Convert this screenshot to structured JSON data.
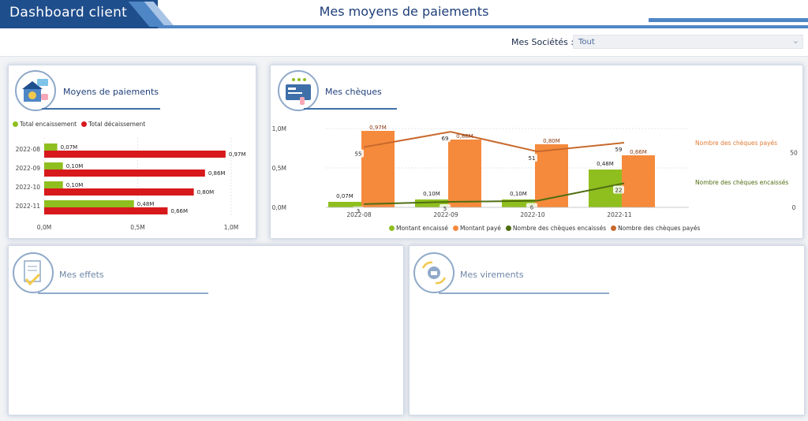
{
  "header": {
    "app_title": "Dashboard client",
    "page_title": "Mes moyens de paiements"
  },
  "filter": {
    "label": "Mes Sociétés :",
    "value": "Tout"
  },
  "panels": {
    "moyens": {
      "title": "Moyens de paiements",
      "legend": [
        "Total encaissement",
        "Total décaissement"
      ]
    },
    "cheques": {
      "title": "Mes chèques",
      "legend": [
        "Montant encaissé",
        "Montant payé",
        "Nombre des chèques encaissés",
        "Nombre des chèques payés"
      ],
      "right_labels": [
        "Nombre des chèques payés",
        "Nombre des chèques encaissés"
      ]
    },
    "effets": {
      "title": "Mes effets"
    },
    "virements": {
      "title": "Mes virements"
    }
  },
  "colors": {
    "green": "#8fbf1f",
    "red": "#d7191c",
    "orange": "#f58a3c",
    "dark_green": "#4f6e12",
    "dark_orange": "#c8692d",
    "accent_blue": "#1f4e8c"
  },
  "chart_data": [
    {
      "type": "bar",
      "orientation": "horizontal",
      "categories": [
        "2022-08",
        "2022-09",
        "2022-10",
        "2022-11"
      ],
      "series": [
        {
          "name": "Total encaissement",
          "values": [
            0.07,
            0.1,
            0.1,
            0.48
          ],
          "labels": [
            "0,07M",
            "0,10M",
            "0,10M",
            "0,48M"
          ]
        },
        {
          "name": "Total décaissement",
          "values": [
            0.97,
            0.86,
            0.8,
            0.66
          ],
          "labels": [
            "0,97M",
            "0,86M",
            "0,80M",
            "0,66M"
          ]
        }
      ],
      "xlim": [
        0,
        1.0
      ],
      "xticks": [
        "0,0M",
        "0,5M",
        "1,0M"
      ],
      "legend": "top-left"
    },
    {
      "type": "bar",
      "categories": [
        "2022-08",
        "2022-09",
        "2022-10",
        "2022-11"
      ],
      "series": [
        {
          "name": "Montant encaissé",
          "values": [
            0.07,
            0.1,
            0.1,
            0.48
          ],
          "labels": [
            "0,07M",
            "0,10M",
            "0,10M",
            "0,48M"
          ]
        },
        {
          "name": "Montant payé",
          "values": [
            0.97,
            0.86,
            0.8,
            0.66
          ],
          "labels": [
            "0,97M",
            "0,86M",
            "0,80M",
            "0,66M"
          ]
        },
        {
          "name": "Nombre des chèques encaissés",
          "type": "line",
          "axis": "right",
          "values": [
            3,
            5,
            6,
            22
          ]
        },
        {
          "name": "Nombre des chèques payés",
          "type": "line",
          "axis": "right",
          "values": [
            55,
            69,
            51,
            59
          ]
        }
      ],
      "ylim": [
        0,
        1.0
      ],
      "yticks": [
        "0,0M",
        "0,5M",
        "1,0M"
      ],
      "y2ticks": [
        "0",
        "50"
      ],
      "y2lim": [
        0,
        72
      ],
      "legend": "bottom"
    }
  ]
}
